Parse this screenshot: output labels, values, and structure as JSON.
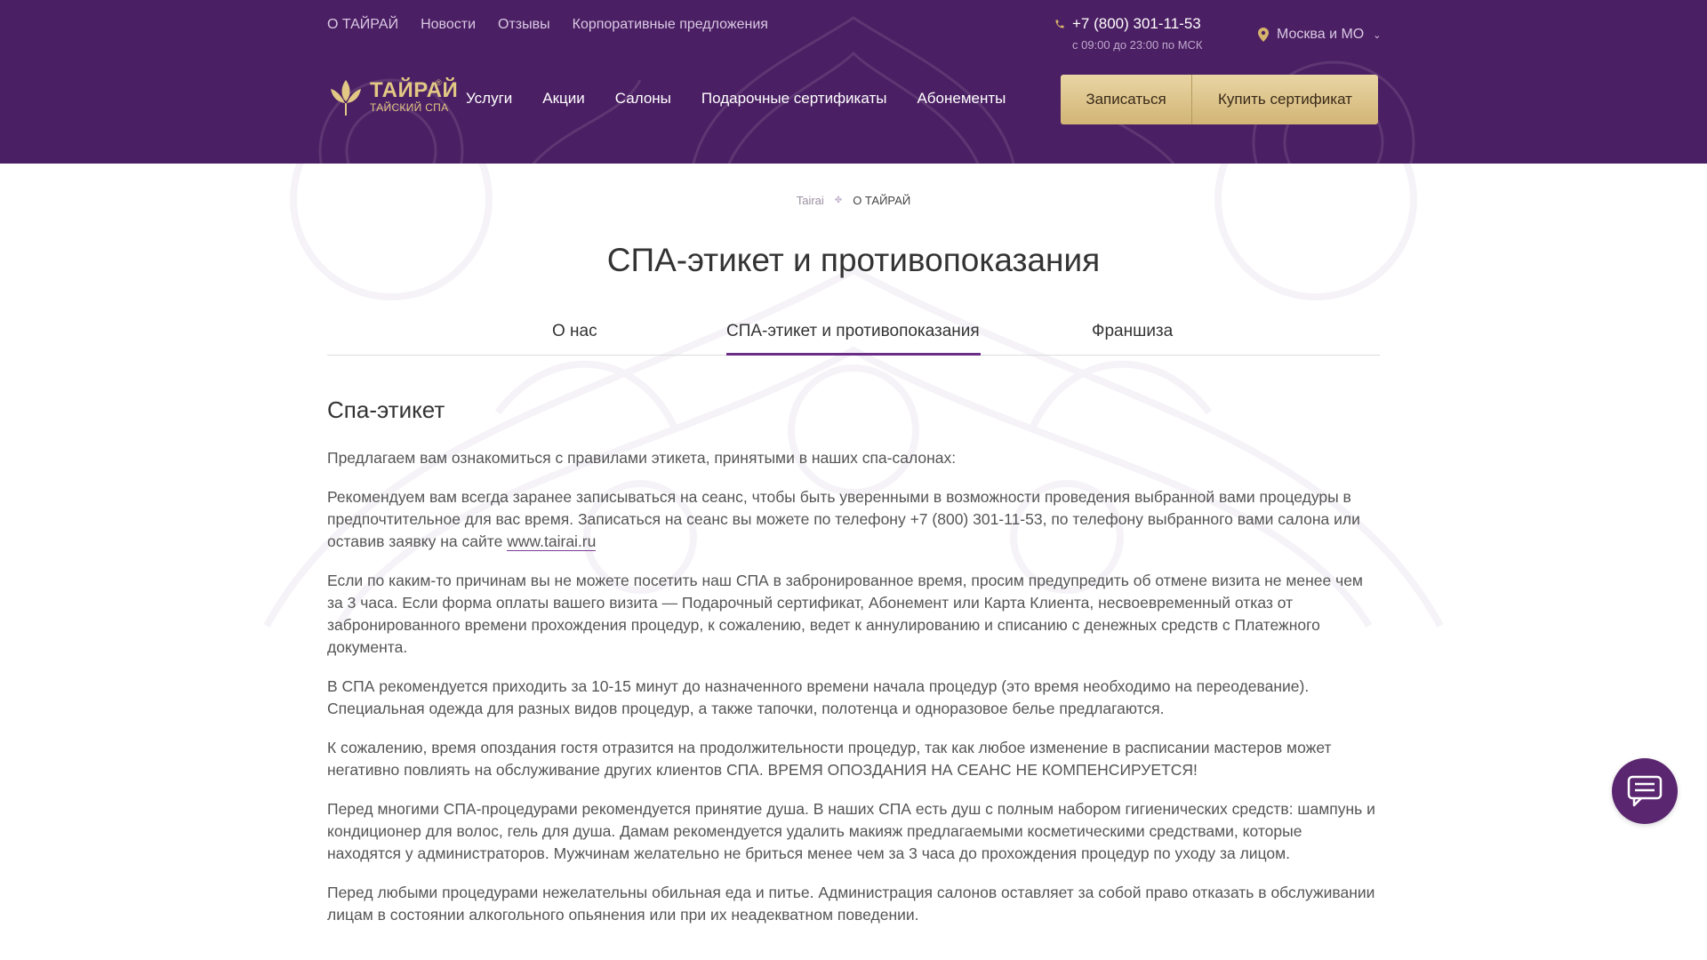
{
  "top_nav": {
    "items": [
      "О ТАЙРАЙ",
      "Новости",
      "Отзывы",
      "Корпоративные предложения"
    ]
  },
  "contact": {
    "phone": "+7 (800) 301-11-53",
    "hours": "с 09:00 до 23:00 по МСК"
  },
  "city": {
    "selected": "Москва и МО"
  },
  "logo": {
    "title": "ТАЙРАЙ",
    "subtitle": "ТАЙСКИЙ СПА",
    "reg": "®"
  },
  "main_nav": {
    "items": [
      "Услуги",
      "Акции",
      "Салоны",
      "Подарочные сертификаты",
      "Абонементы"
    ]
  },
  "cta": {
    "book_label": "Записаться",
    "cert_label": "Купить сертификат"
  },
  "breadcrumb": {
    "home": "Tairai",
    "separator": "✤",
    "current": "О ТАЙРАЙ"
  },
  "page": {
    "title": "СПА-этикет и противопоказания"
  },
  "tabs": {
    "items": [
      "О нас",
      "СПА-этикет и противопоказания",
      "Франшиза"
    ],
    "active": "СПА-этикет и противопоказания"
  },
  "content": {
    "heading": "Спа-этикет",
    "p1": "Предлагаем вам ознакомиться с правилами этикета, принятыми в наших спа-салонах:",
    "p2_text": "Рекомендуем вам всегда заранее записываться на сеанс, чтобы быть уверенными в возможности проведения выбранной вами процедуры в предпочтительное для вас время. Записаться на сеанс вы можете по телефону +7 (800) 301-11-53, по телефону выбранного вами салона или оставив заявку на сайте ",
    "p2_link": "www.tairai.ru",
    "p3": "Если по каким-то причинам вы не можете посетить наш СПА в забронированное время, просим предупредить об отмене визита не менее чем за 3 часа. Если форма оплаты вашего визита — Подарочный сертификат, Абонемент или Карта Клиента, несвоевременный отказ от забронированного времени прохождения процедур, к сожалению, ведет к аннулированию и списанию с денежных средств с Платежного документа.",
    "p4": "В СПА рекомендуется приходить за 10-15 минут до назначенного времени начала процедур (это время необходимо на переодевание). Специальная одежда для разных видов процедур, а также тапочки, полотенца и одноразовое белье предлагаются.",
    "p5": "К сожалению, время опоздания гостя отразится на продолжительности процедур, так как любое изменение в расписании мастеров может негативно повлиять на обслуживание других клиентов СПА. ВРЕМЯ ОПОЗДАНИЯ НА СЕАНС НЕ КОМПЕНСИРУЕТСЯ!",
    "p6": "Перед многими СПА-процедурами рекомендуется принятие душа. В наших СПА есть душ с полным набором гигиенических средств: шампунь и кондиционер для волос, гель для душа. Дамам рекомендуется удалить макияж предлагаемыми косметическими средствами, которые находятся у администраторов. Мужчинам желательно не бриться менее чем за 3 часа до прохождения процедур по уходу за лицом.",
    "p7": "Перед любыми процедурами нежелательны обильная еда и питье. Администрация салонов оставляет за собой право отказать в обслуживании лицам в состоянии алкогольного опьянения или при их неадекватном поведении."
  },
  "colors": {
    "header_bg": "#4b1f63",
    "gold": "#d2b576",
    "accent": "#6b2d87"
  },
  "icons": [
    "phone-icon",
    "location-pin-icon",
    "chevron-down-icon",
    "lotus-logo-icon",
    "chat-icon"
  ]
}
